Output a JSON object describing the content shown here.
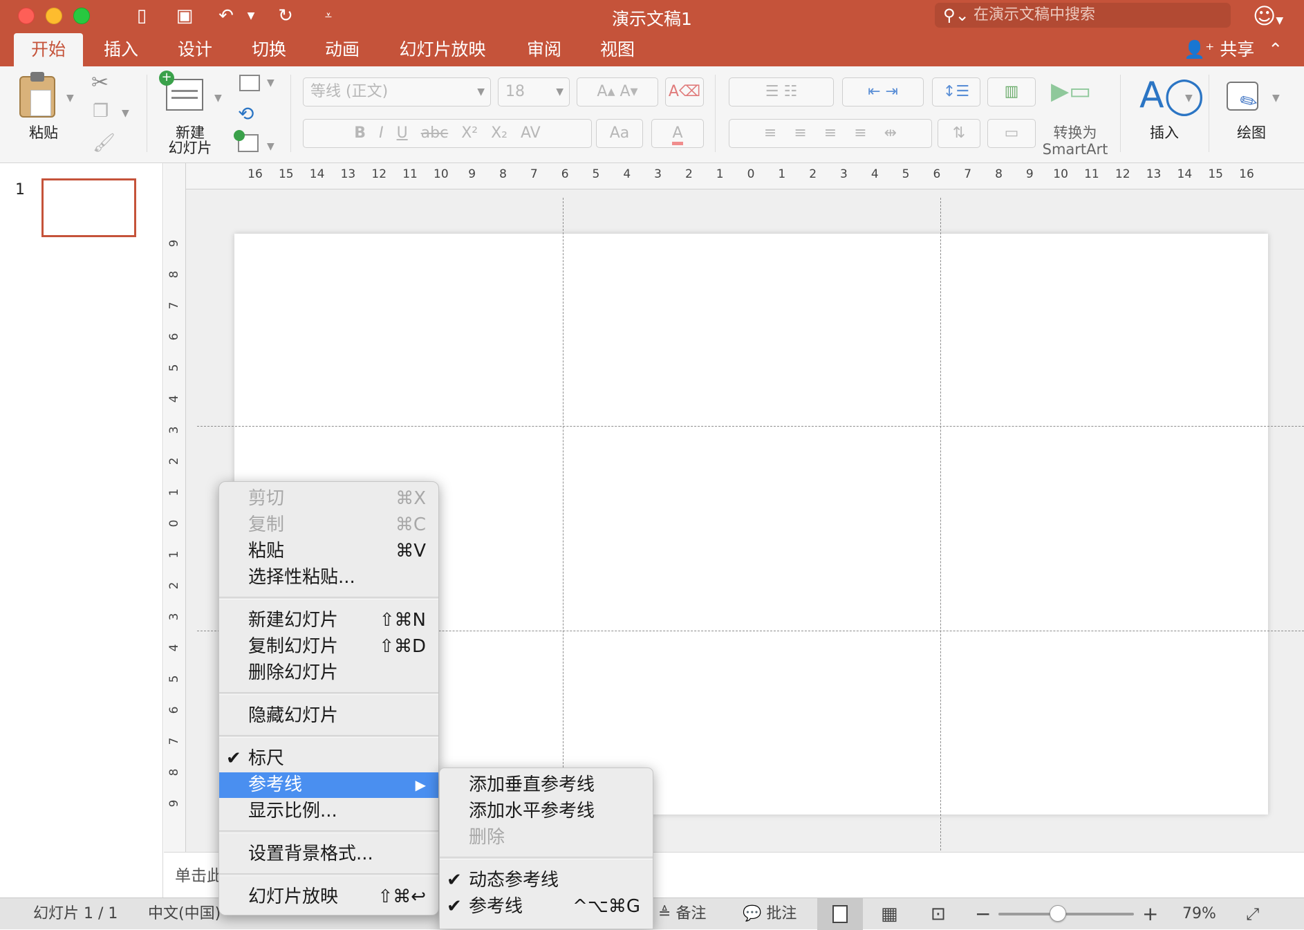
{
  "window": {
    "title": "演示文稿1",
    "search_placeholder": "在演示文稿中搜索",
    "accent_color": "#c5533a"
  },
  "tabs": [
    {
      "label": "开始",
      "active": true
    },
    {
      "label": "插入"
    },
    {
      "label": "设计"
    },
    {
      "label": "切换"
    },
    {
      "label": "动画"
    },
    {
      "label": "幻灯片放映"
    },
    {
      "label": "审阅"
    },
    {
      "label": "视图"
    }
  ],
  "share_label": "共享",
  "ribbon": {
    "paste": "粘贴",
    "new_slide_line1": "新建",
    "new_slide_line2": "幻灯片",
    "font_name": "等线 (正文)",
    "font_size": "18",
    "convert_smartart_line1": "转换为",
    "convert_smartart_line2": "SmartArt",
    "insert": "插入",
    "draw": "绘图"
  },
  "slides_panel": {
    "slide_number": "1"
  },
  "ruler": {
    "horizontal": [
      "16",
      "15",
      "14",
      "13",
      "12",
      "11",
      "10",
      "9",
      "8",
      "7",
      "6",
      "5",
      "4",
      "3",
      "2",
      "1",
      "0",
      "1",
      "2",
      "3",
      "4",
      "5",
      "6",
      "7",
      "8",
      "9",
      "10",
      "11",
      "12",
      "13",
      "14",
      "15",
      "16"
    ],
    "vertical": [
      "9",
      "8",
      "7",
      "6",
      "5",
      "4",
      "3",
      "2",
      "1",
      "0",
      "1",
      "2",
      "3",
      "4",
      "5",
      "6",
      "7",
      "8",
      "9"
    ]
  },
  "notes_placeholder": "单击此",
  "context_menu": {
    "items": [
      {
        "label": "剪切",
        "shortcut": "⌘X",
        "disabled": true
      },
      {
        "label": "复制",
        "shortcut": "⌘C",
        "disabled": true
      },
      {
        "label": "粘贴",
        "shortcut": "⌘V"
      },
      {
        "label": "选择性粘贴..."
      },
      {
        "label": "新建幻灯片",
        "shortcut": "⇧⌘N"
      },
      {
        "label": "复制幻灯片",
        "shortcut": "⇧⌘D"
      },
      {
        "label": "删除幻灯片"
      },
      {
        "label": "隐藏幻灯片"
      },
      {
        "label": "标尺",
        "checked": true
      },
      {
        "label": "参考线",
        "highlighted": true,
        "submenu": true
      },
      {
        "label": "显示比例..."
      },
      {
        "label": "设置背景格式..."
      },
      {
        "label": "幻灯片放映",
        "shortcut": "⇧⌘↩"
      }
    ],
    "highlight_color": "#4a8ff0"
  },
  "submenu": {
    "items": [
      {
        "label": "添加垂直参考线"
      },
      {
        "label": "添加水平参考线"
      },
      {
        "label": "删除",
        "disabled": true
      },
      {
        "label": "动态参考线",
        "checked": true
      },
      {
        "label": "参考线",
        "checked": true,
        "shortcut": "^⌥⌘G"
      }
    ]
  },
  "statusbar": {
    "slide_info": "幻灯片 1 / 1",
    "language": "中文(中国)",
    "notes": "备注",
    "comments": "批注",
    "zoom": "79%",
    "zoom_level": 0.44
  }
}
